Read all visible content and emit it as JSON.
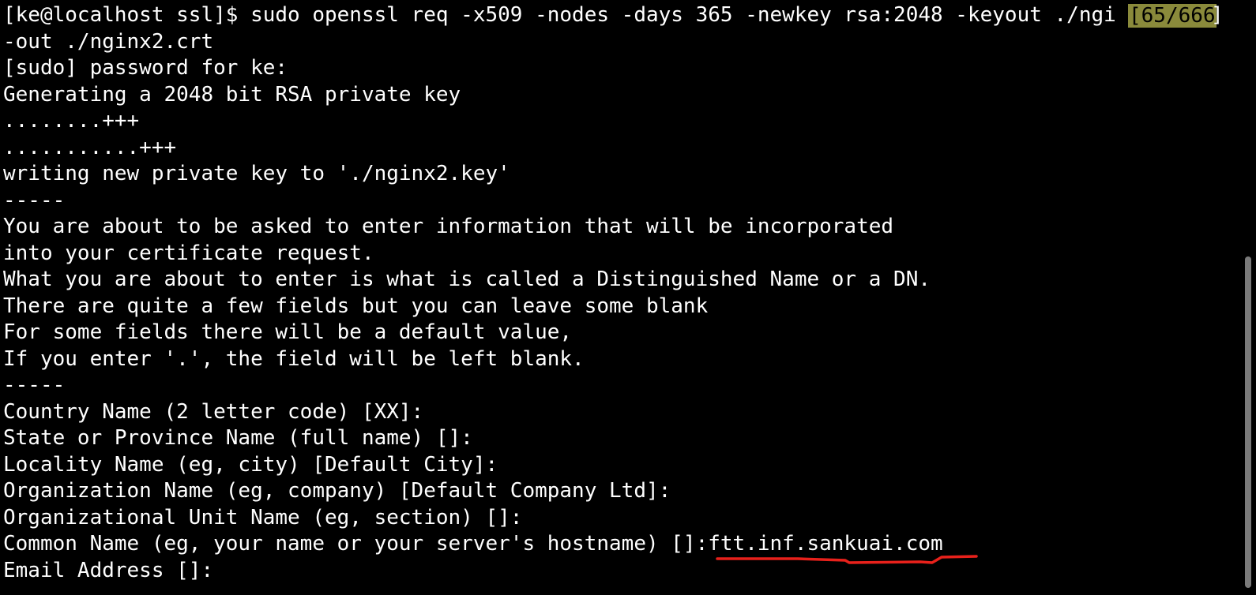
{
  "terminal": {
    "lines": [
      "[ke@localhost ssl]$ sudo openssl req -x509 -nodes -days 365 -newkey rsa:2048 -keyout ./ngi",
      "-out ./nginx2.crt",
      "[sudo] password for ke:",
      "Generating a 2048 bit RSA private key",
      "........+++",
      "...........+++",
      "writing new private key to './nginx2.key'",
      "-----",
      "You are about to be asked to enter information that will be incorporated",
      "into your certificate request.",
      "What you are about to enter is what is called a Distinguished Name or a DN.",
      "There are quite a few fields but you can leave some blank",
      "For some fields there will be a default value,",
      "If you enter '.', the field will be left blank.",
      "-----",
      "Country Name (2 letter code) [XX]:",
      "State or Province Name (full name) []:",
      "Locality Name (eg, city) [Default City]:",
      "Organization Name (eg, company) [Default Company Ltd]:",
      "Organizational Unit Name (eg, section) []:",
      "Common Name (eg, your name or your server's hostname) []:",
      "Email Address []:"
    ],
    "common_name_value": "ftt.inf.sankuai.com",
    "line_position_indicator": "[65/666",
    "indicator_close": "]"
  },
  "colors": {
    "background": "#000000",
    "text": "#ffffff",
    "indicator_bg": "#8a8a3b",
    "annotation_underline": "#e8211b",
    "scrollbar": "#7a7a7a"
  }
}
